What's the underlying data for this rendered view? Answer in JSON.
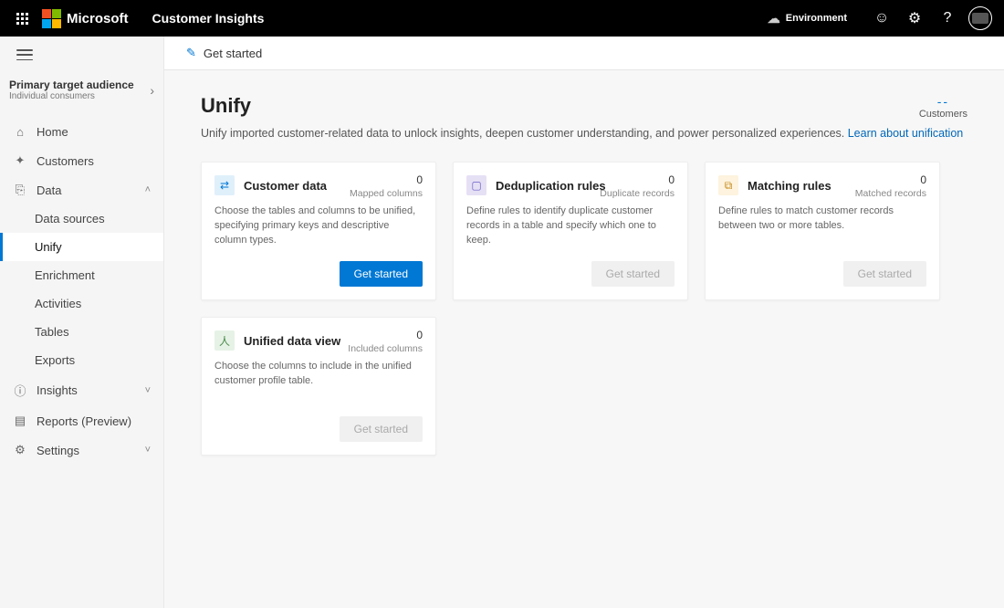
{
  "header": {
    "brand": "Microsoft",
    "app_name": "Customer Insights",
    "environment_label": "Environment"
  },
  "sidebar": {
    "audience_title": "Primary target audience",
    "audience_subtitle": "Individual consumers",
    "items": [
      {
        "label": "Home",
        "icon": "⌂"
      },
      {
        "label": "Customers",
        "icon": "✦"
      },
      {
        "label": "Data",
        "icon": "⎘",
        "expanded": true,
        "children": [
          {
            "label": "Data sources"
          },
          {
            "label": "Unify",
            "active": true
          },
          {
            "label": "Enrichment"
          },
          {
            "label": "Activities"
          },
          {
            "label": "Tables"
          },
          {
            "label": "Exports"
          }
        ]
      },
      {
        "label": "Insights",
        "icon": "ⓘ",
        "expandable": true
      },
      {
        "label": "Reports (Preview)",
        "icon": "▤"
      },
      {
        "label": "Settings",
        "icon": "⚙",
        "expandable": true
      }
    ]
  },
  "command_bar": {
    "get_started": "Get started"
  },
  "page": {
    "title": "Unify",
    "description": "Unify imported customer-related data to unlock insights, deepen customer understanding, and power personalized experiences. ",
    "learn_link": "Learn about unification",
    "kpi_value": "--",
    "kpi_label": "Customers"
  },
  "cards": [
    {
      "title": "Customer data",
      "metric_value": "0",
      "metric_label": "Mapped columns",
      "description": "Choose the tables and columns to be unified, specifying primary keys and descriptive column types.",
      "button_label": "Get started",
      "button_enabled": true,
      "icon_class": "ci-blue",
      "icon_glyph": "⇄"
    },
    {
      "title": "Deduplication rules",
      "metric_value": "0",
      "metric_label": "Duplicate records",
      "description": "Define rules to identify duplicate customer records in a table and specify which one to keep.",
      "button_label": "Get started",
      "button_enabled": false,
      "icon_class": "ci-purple",
      "icon_glyph": "▢"
    },
    {
      "title": "Matching rules",
      "metric_value": "0",
      "metric_label": "Matched records",
      "description": "Define rules to match customer records between two or more tables.",
      "button_label": "Get started",
      "button_enabled": false,
      "icon_class": "ci-orange",
      "icon_glyph": "⧉"
    },
    {
      "title": "Unified data view",
      "metric_value": "0",
      "metric_label": "Included columns",
      "description": "Choose the columns to include in the unified customer profile table.",
      "button_label": "Get started",
      "button_enabled": false,
      "icon_class": "ci-green",
      "icon_glyph": "人"
    }
  ]
}
